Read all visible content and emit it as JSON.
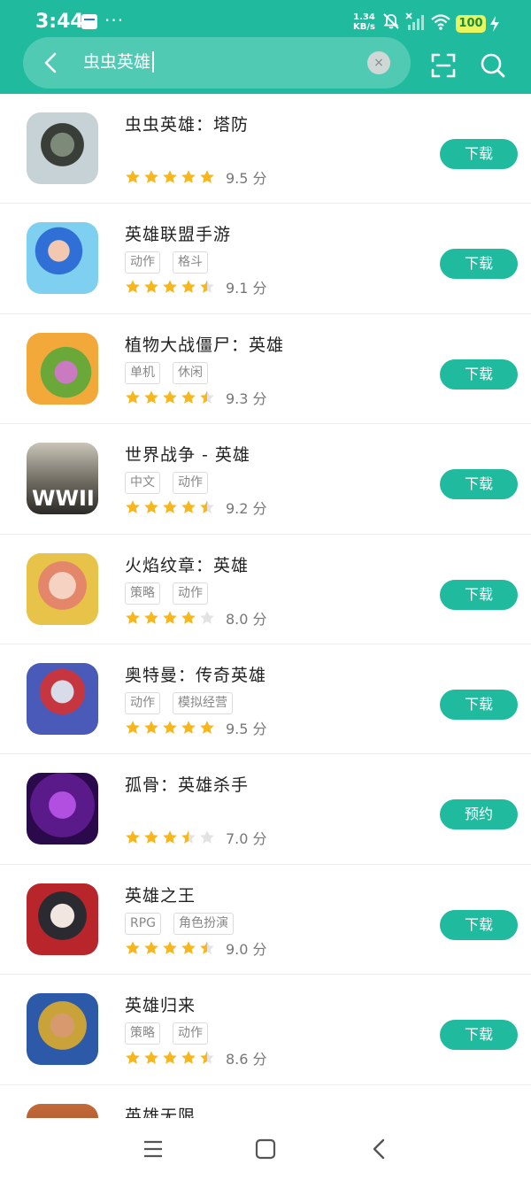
{
  "status_bar": {
    "time": "3:44",
    "more": "···",
    "net_speed_value": "1.34",
    "net_speed_unit": "KB/s",
    "battery": "100"
  },
  "search": {
    "query": "虫虫英雄",
    "clear_label": "×"
  },
  "icons": {
    "back": "back-arrow-icon",
    "clear": "clear-icon",
    "scan": "scan-icon",
    "search": "search-icon",
    "menu": "menu-icon",
    "home": "home-icon",
    "nav_back": "nav-back-icon"
  },
  "colors": {
    "accent": "#20bb9f",
    "star": "#f7b71c",
    "star_empty": "#e3e3e3"
  },
  "results": [
    {
      "name": "虫虫英雄：塔防",
      "tags": [],
      "rating": 5,
      "score": "9.5 分",
      "button": "下载"
    },
    {
      "name": "英雄联盟手游",
      "tags": [
        "动作",
        "格斗"
      ],
      "rating": 4.5,
      "score": "9.1 分",
      "button": "下载"
    },
    {
      "name": "植物大战僵尸：英雄",
      "tags": [
        "单机",
        "休闲"
      ],
      "rating": 4.5,
      "score": "9.3 分",
      "button": "下载"
    },
    {
      "name": "世界战争 - 英雄",
      "tags": [
        "中文",
        "动作"
      ],
      "rating": 4.5,
      "score": "9.2 分",
      "button": "下载",
      "icon_text": "WWII"
    },
    {
      "name": "火焰纹章：英雄",
      "tags": [
        "策略",
        "动作"
      ],
      "rating": 4,
      "score": "8.0 分",
      "button": "下载"
    },
    {
      "name": "奥特曼：传奇英雄",
      "tags": [
        "动作",
        "模拟经营"
      ],
      "rating": 5,
      "score": "9.5 分",
      "button": "下载"
    },
    {
      "name": "孤骨：英雄杀手",
      "tags": [],
      "rating": 3.5,
      "score": "7.0 分",
      "button": "预约"
    },
    {
      "name": "英雄之王",
      "tags": [
        "RPG",
        "角色扮演"
      ],
      "rating": 4.5,
      "score": "9.0 分",
      "button": "下载"
    },
    {
      "name": "英雄归来",
      "tags": [
        "策略",
        "动作"
      ],
      "rating": 4.5,
      "score": "8.6 分",
      "button": "下载"
    },
    {
      "name": "英雄无限",
      "tags": [],
      "rating": null,
      "score": "",
      "button": ""
    }
  ]
}
